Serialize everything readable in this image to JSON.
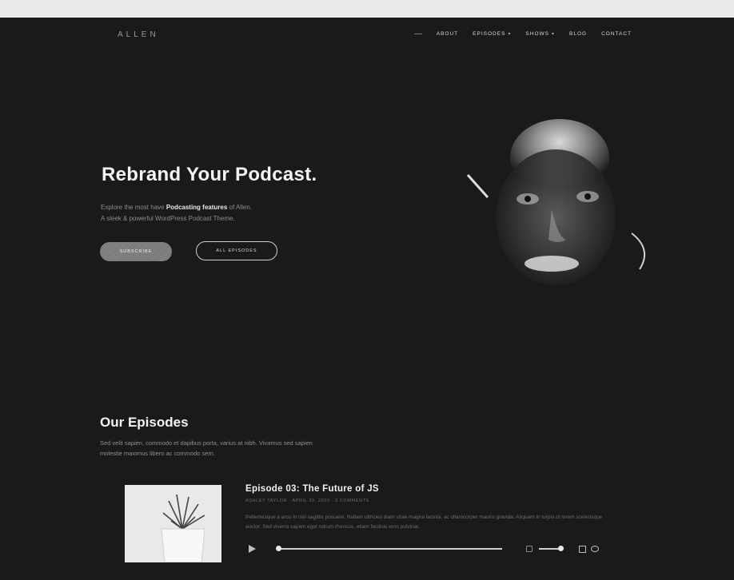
{
  "header": {
    "logo": "ALLEN",
    "nav": [
      {
        "label": "",
        "has_caret": false
      },
      {
        "label": "About",
        "has_caret": false
      },
      {
        "label": "Episodes",
        "has_caret": true
      },
      {
        "label": "Shows",
        "has_caret": true
      },
      {
        "label": "Blog",
        "has_caret": false
      },
      {
        "label": "Contact",
        "has_caret": false
      }
    ]
  },
  "hero": {
    "title": "Rebrand Your Podcast.",
    "desc_pre": "Explore the most have ",
    "desc_bold": "Podcasting features",
    "desc_post": " of Allen.",
    "desc_line2": "A sleek & powerful WordPress Podcast Theme.",
    "subscribe_label": "Subscribe",
    "all_episodes_label": "All Episodes"
  },
  "episodes_section": {
    "title": "Our Episodes",
    "desc": "Sed velit sapien, commodo et dapibus porta, varius at nibh. Vivamus sed sapien molestie maximus libero ac commodo sem."
  },
  "episode": {
    "title": "Episode 03: The Future of JS",
    "meta": "ASHLEY TAYLOR · APRIL 30, 2020 · 3 COMMENTS",
    "excerpt": "Pellentesque a arcu in nisi sagittis posuere. Nullam ultricies diam vitae magna lacinia, ac ullamcorper mauris gravida. Aliquam in turpis ut lorem scelerisque auctor. Sed viverra sapien eget rutrum rhoncus, etiam facilisis eros pulvinar."
  },
  "player": {
    "progress": 0,
    "volume": 1
  },
  "colors": {
    "background": "#1a1a1c",
    "topbar": "#e8e9ea",
    "text": "#f4f4f4"
  }
}
